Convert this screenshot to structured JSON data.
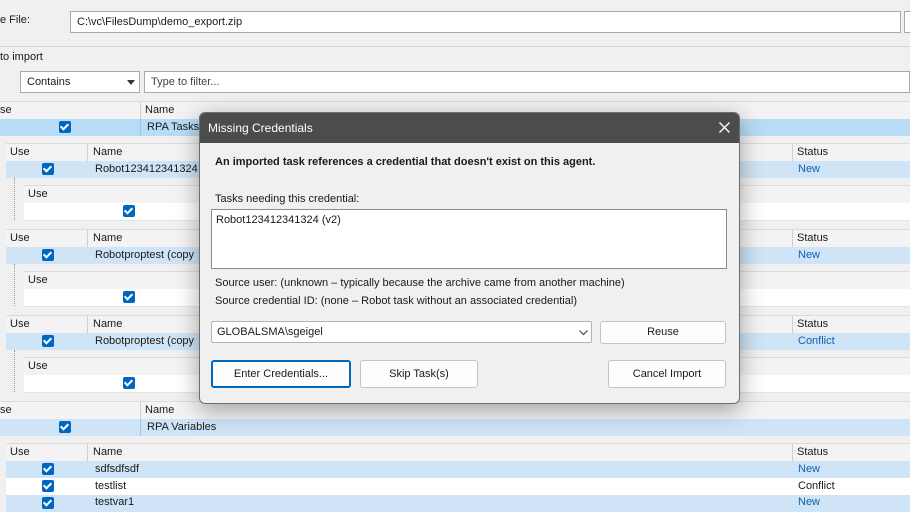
{
  "file": {
    "label": "e File:",
    "path": "C:\\vc\\FilesDump\\demo_export.zip"
  },
  "import_label": "to import",
  "filter": {
    "mode": "Contains",
    "placeholder": "Type to filter..."
  },
  "columns": {
    "use": "Use",
    "name": "Name",
    "status": "Status",
    "use_partial": "se"
  },
  "groups": {
    "rpa_tasks": "RPA Tasks",
    "rpa_variables": "RPA Variables"
  },
  "tasks": [
    {
      "name": "Robot123412341324",
      "status": "New"
    },
    {
      "name": "Robotproptest (copy",
      "status": "New"
    },
    {
      "name": "Robotproptest (copy",
      "status": "Conflict"
    }
  ],
  "variables": [
    {
      "name": "sdfsdfsdf",
      "status": "New"
    },
    {
      "name": "testlist",
      "status": "Conflict"
    },
    {
      "name": "testvar1",
      "status": "New"
    }
  ],
  "dialog": {
    "title": "Missing Credentials",
    "heading": "An imported task references a credential that doesn't exist on this agent.",
    "tasks_label": "Tasks needing this credential:",
    "tasks_list": "Robot123412341324 (v2)",
    "source_user": "Source user: (unknown – typically because the archive came from another machine)",
    "source_credential": "Source credential ID: (none – Robot task without an associated credential)",
    "credential_selected": "GLOBALSMA\\sgeigel",
    "buttons": {
      "reuse": "Reuse",
      "enter_credentials": "Enter Credentials...",
      "skip_tasks": "Skip Task(s)",
      "cancel_import": "Cancel Import"
    }
  },
  "icons": {
    "close": "close-icon",
    "dropdown": "chevron-down-icon",
    "checkbox": "checkbox-checked-icon"
  },
  "colors": {
    "accent": "#0067c0",
    "title_bar": "#4c4c4c",
    "selected_row": "#b8dcf5"
  }
}
